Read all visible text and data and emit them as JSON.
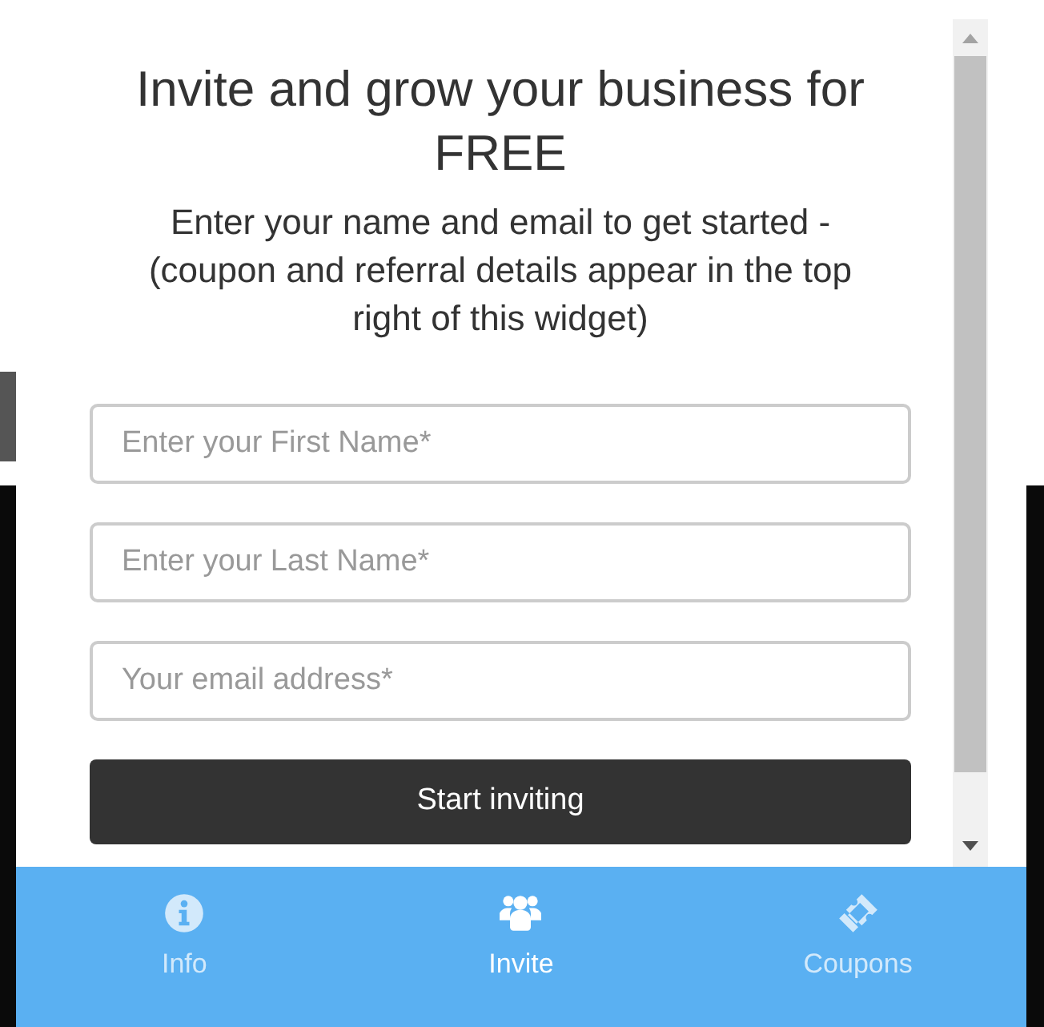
{
  "heading": "Invite and grow your business for FREE",
  "subheading": "Enter your name and email to get started - (coupon and referral details appear in the top right of this widget)",
  "fields": [
    {
      "placeholder": "Enter your First Name*"
    },
    {
      "placeholder": "Enter your Last Name*"
    },
    {
      "placeholder": "Your email address*"
    }
  ],
  "submit_button": "Start inviting",
  "tabs": [
    {
      "label": "Info",
      "kind": "info",
      "selected": false
    },
    {
      "label": "Invite",
      "kind": "people",
      "selected": true
    },
    {
      "label": "Coupons",
      "kind": "ticket",
      "selected": false
    }
  ]
}
